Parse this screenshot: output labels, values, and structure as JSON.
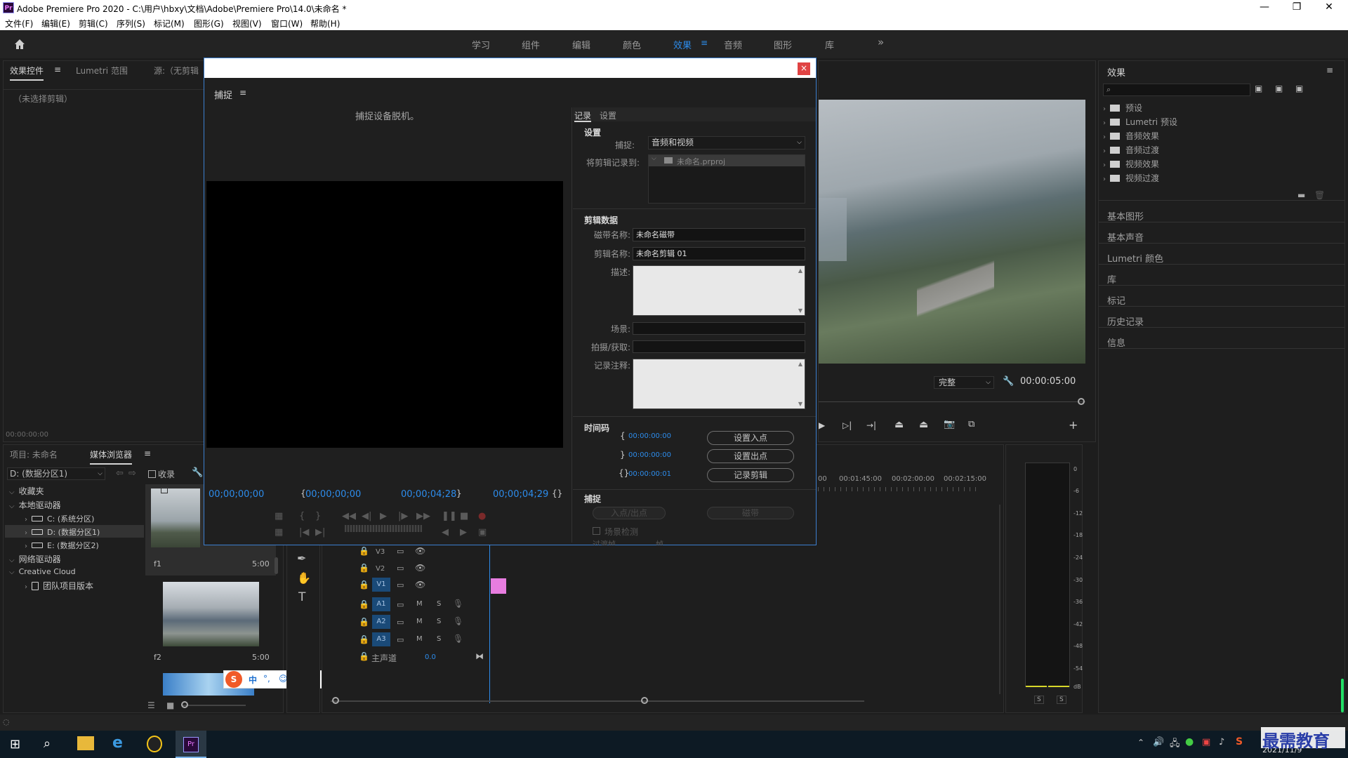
{
  "window": {
    "title": "Adobe Premiere Pro 2020 - C:\\用户\\hbxy\\文档\\Adobe\\Premiere Pro\\14.0\\未命名 *",
    "app_badge": "Pr",
    "minimize": "—",
    "restore": "❐",
    "close": "✕"
  },
  "menu": [
    "文件(F)",
    "编辑(E)",
    "剪辑(C)",
    "序列(S)",
    "标记(M)",
    "图形(G)",
    "视图(V)",
    "窗口(W)",
    "帮助(H)"
  ],
  "workspaces": [
    "学习",
    "组件",
    "编辑",
    "颜色",
    "效果",
    "音频",
    "图形",
    "库"
  ],
  "workspace_active": "效果",
  "workspace_more": "»",
  "effect_controls": {
    "tabs": [
      "效果控件",
      "Lumetri 范围",
      "源:（无剪辑"
    ],
    "no_clip": "（未选择剪辑）",
    "timecode": "00:00:00:00"
  },
  "project": {
    "tabs": [
      "项目: 未命名",
      "媒体浏览器"
    ],
    "drive_select": "D: (数据分区1)",
    "favorite_label": "收录",
    "tree": [
      {
        "label": "收藏夹",
        "level": 0
      },
      {
        "label": "本地驱动器",
        "level": 0
      },
      {
        "label": "C: (系统分区)",
        "level": 1
      },
      {
        "label": "D: (数据分区1)",
        "level": 1
      },
      {
        "label": "E: (数据分区2)",
        "level": 1
      },
      {
        "label": "网络驱动器",
        "level": 0
      },
      {
        "label": "Creative Cloud",
        "level": 0
      },
      {
        "label": "团队项目版本",
        "level": 1
      }
    ],
    "clips": [
      {
        "name": "f1",
        "duration": "5:00"
      },
      {
        "name": "f2",
        "duration": "5:00"
      }
    ]
  },
  "dialog": {
    "title": "捕捉",
    "offline": "捕捉设备脱机。",
    "close": "×",
    "timecodes": {
      "current": "00;00;00;00",
      "in": "00;00;00;00",
      "out": "00;00;04;28",
      "duration": "00;00;04;29"
    },
    "tabs": [
      "记录",
      "设置"
    ],
    "setup": {
      "section": "设置",
      "capture_label": "捕捉:",
      "capture_value": "音频和视频",
      "log_to_label": "将剪辑记录到:",
      "log_to_value": "未命名.prproj"
    },
    "clip_data": {
      "section": "剪辑数据",
      "tape_label": "磁带名称:",
      "tape_value": "未命名磁带",
      "clip_label": "剪辑名称:",
      "clip_value": "未命名剪辑 01",
      "desc_label": "描述:",
      "scene_label": "场景:",
      "shot_label": "拍摄/获取:",
      "log_note_label": "记录注释:"
    },
    "timecode": {
      "section": "时间码",
      "in_tc": "00:00:00:00",
      "out_tc": "00:00:00:00",
      "dur_tc": "00:00:00:01",
      "set_in": "设置入点",
      "set_out": "设置出点",
      "log_clip": "记录剪辑"
    },
    "capture": {
      "section": "捕捉",
      "in_out": "入点/出点",
      "tape": "磁带",
      "scene_detect": "场景检测",
      "handles": "过渡帧",
      "frames": "帧"
    }
  },
  "program": {
    "fit": "完整",
    "timecode": "00:00:05:00"
  },
  "timeline": {
    "ruler": [
      "00",
      "00:01:45:00",
      "00:02:00:00",
      "00:02:15:00"
    ],
    "video_tracks": [
      "V3",
      "V2",
      "V1"
    ],
    "audio_tracks": [
      "A1",
      "A2",
      "A3"
    ],
    "master": "主声道",
    "master_val": "0.0",
    "mute": "M",
    "solo": "S"
  },
  "effects": {
    "title": "效果",
    "tree": [
      "预设",
      "Lumetri 预设",
      "音频效果",
      "音频过渡",
      "视频效果",
      "视频过渡"
    ],
    "panels": [
      "基本图形",
      "基本声音",
      "Lumetri 颜色",
      "库",
      "标记",
      "历史记录",
      "信息"
    ]
  },
  "meter": {
    "scale": [
      "0",
      "-6",
      "-12",
      "-18",
      "-24",
      "-30",
      "-36",
      "-42",
      "-48",
      "-54",
      "dB"
    ],
    "solo": [
      "S",
      "S"
    ]
  },
  "ime": {
    "mode": "中",
    "punct": "°,"
  },
  "taskbar": {
    "date": "2021/11/9",
    "watermark": "最需教育"
  },
  "colors": {
    "accent": "#2d8ceb",
    "clip": "#e87de0",
    "close": "#e04343"
  }
}
